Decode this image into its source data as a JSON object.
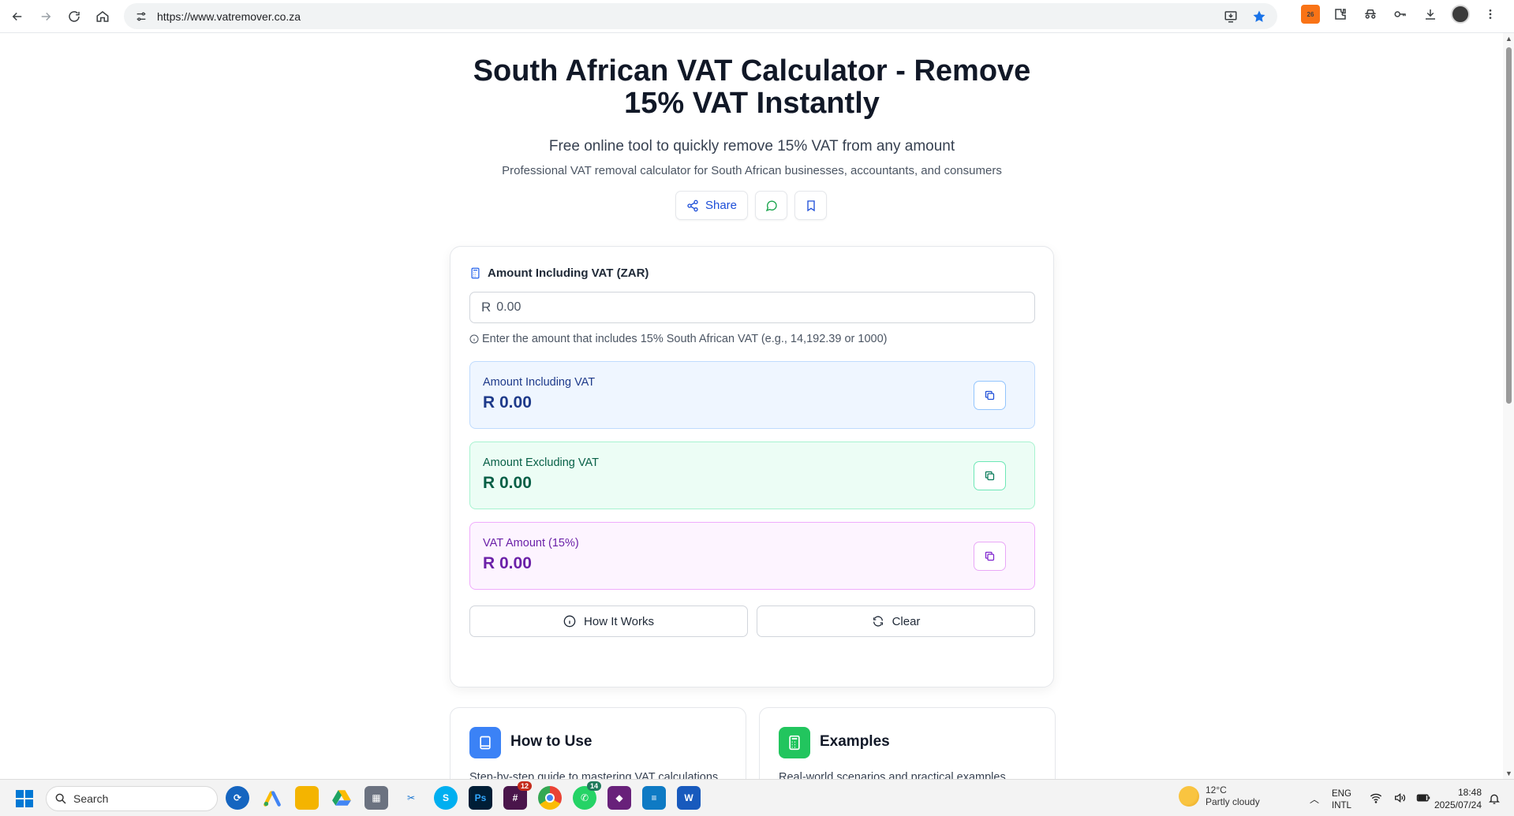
{
  "browser": {
    "url": "https://www.vatremover.co.za",
    "ext_badge": "26"
  },
  "page": {
    "title": "South African VAT Calculator - Remove 15% VAT Instantly",
    "subtitle": "Free online tool to quickly remove 15% VAT from any amount",
    "tagline": "Professional VAT removal calculator for South African businesses, accountants, and consumers",
    "share_label": "Share"
  },
  "calculator": {
    "input_label": "Amount Including VAT (ZAR)",
    "currency_symbol": "R",
    "input_placeholder": "0.00",
    "input_hint": "Enter the amount that includes 15% South African VAT (e.g., 14,192.39 or 1000)",
    "results": [
      {
        "label": "Amount Including VAT",
        "value": "R 0.00"
      },
      {
        "label": "Amount Excluding VAT",
        "value": "R 0.00"
      },
      {
        "label": "VAT Amount (15%)",
        "value": "R 0.00"
      }
    ],
    "how_it_works_label": "How It Works",
    "clear_label": "Clear"
  },
  "info_cards": [
    {
      "title": "How to Use",
      "text": "Step-by-step guide to mastering VAT calculations. Learn real-time calculation techniques and copy functionality.",
      "icon": "book-icon",
      "color": "#3b82f6"
    },
    {
      "title": "Examples",
      "text": "Real-world scenarios and practical examples. From small business to retail - see VAT removal in action.",
      "icon": "calculator-icon",
      "color": "#22c55e"
    }
  ],
  "taskbar": {
    "search_label": "Search",
    "slack_badge": "12",
    "whatsapp_badge": "14",
    "weather_temp": "12°C",
    "weather_desc": "Partly cloudy",
    "lang_line1": "ENG",
    "lang_line2": "INTL",
    "time": "18:48",
    "date": "2025/07/24"
  }
}
